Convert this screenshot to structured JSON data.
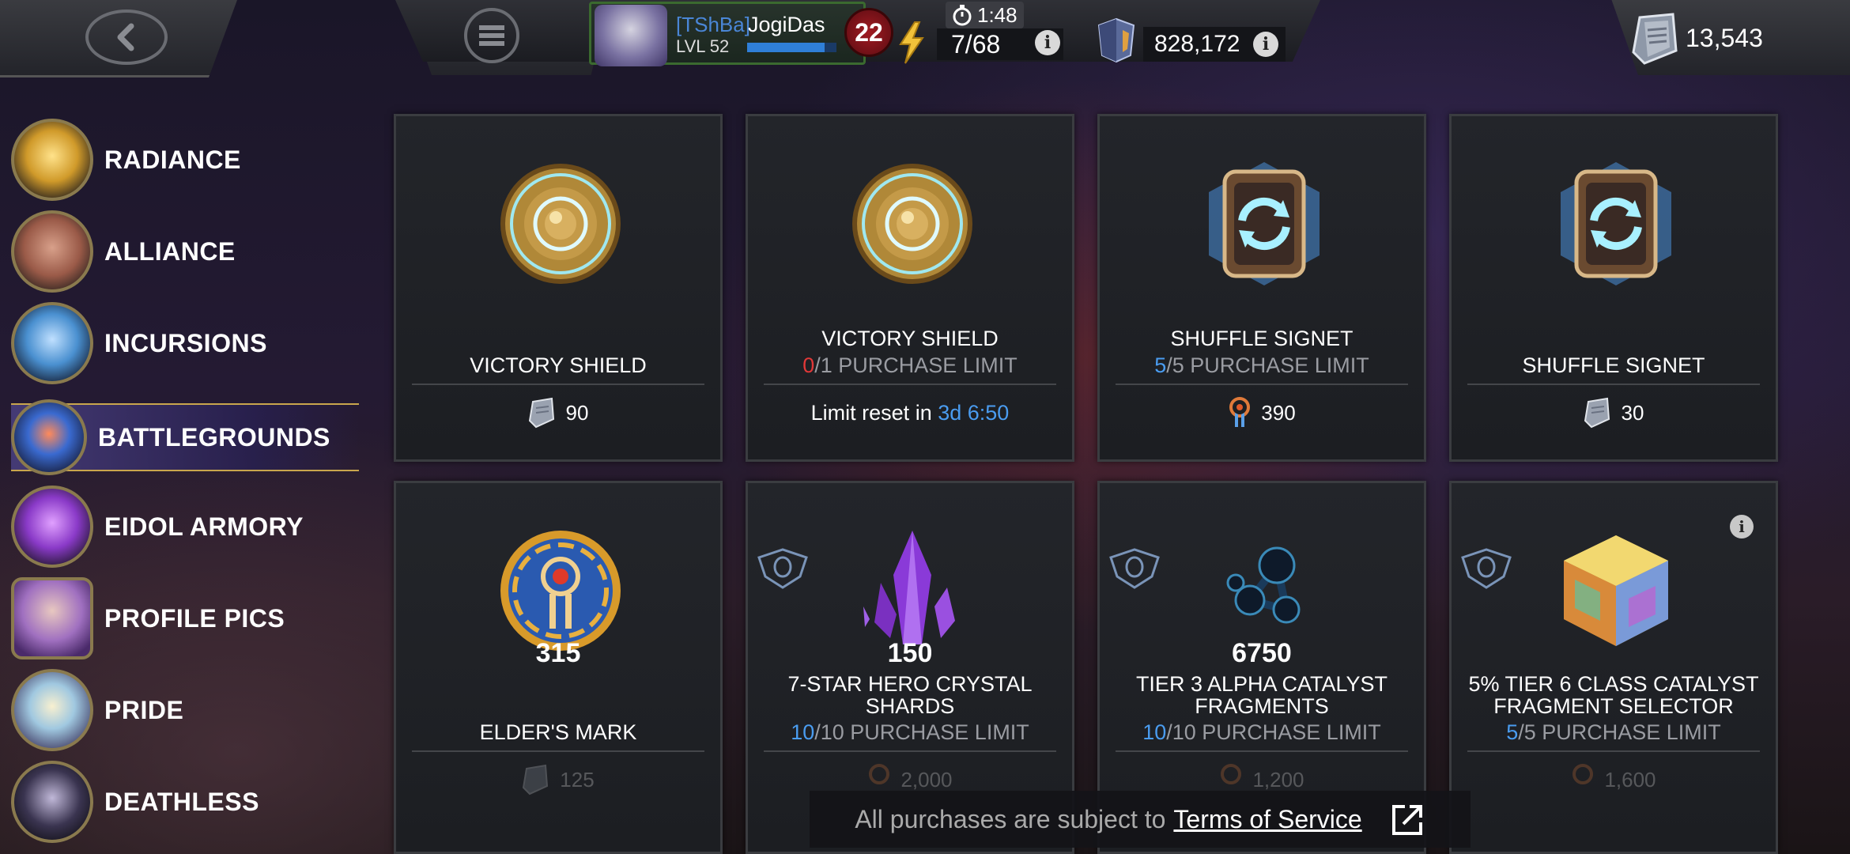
{
  "topbar": {
    "clan_tag": "[TShBa]",
    "player_name": "JogiDas",
    "level": "LVL 52",
    "level_badge": "22",
    "xp_progress": 0.87,
    "timer": "1:48",
    "energy": "7/68",
    "units": "828,172",
    "battlegrounds_currency": "13,543",
    "icons": {
      "back": "back-arrow-icon",
      "menu": "menu-icon",
      "energy": "lightning-icon",
      "timer": "stopwatch-icon",
      "units": "units-crystal-icon",
      "bg_currency": "glory-token-icon",
      "info": "info-icon"
    }
  },
  "sidebar": {
    "items": [
      {
        "label": "RADIANCE",
        "icon": "radiance-icon"
      },
      {
        "label": "ALLIANCE",
        "icon": "alliance-shield-icon"
      },
      {
        "label": "INCURSIONS",
        "icon": "incursions-icon"
      },
      {
        "label": "BATTLEGROUNDS",
        "icon": "battlegrounds-icon",
        "active": true
      },
      {
        "label": "EIDOL ARMORY",
        "icon": "eidol-armory-icon"
      },
      {
        "label": "PROFILE PICS",
        "icon": "profile-pic-icon"
      },
      {
        "label": "PRIDE",
        "icon": "pride-icon"
      },
      {
        "label": "DEATHLESS",
        "icon": "deathless-icon"
      }
    ]
  },
  "cards": [
    {
      "name": "VICTORY SHIELD",
      "price": "90",
      "currency_icon": "glory-token-icon"
    },
    {
      "name": "VICTORY SHIELD",
      "limit_current": "0",
      "limit_rest": "/1 PURCHASE LIMIT",
      "reset_prefix": "Limit reset in",
      "reset_time": "3d 6:50"
    },
    {
      "name": "SHUFFLE SIGNET",
      "limit_current": "5",
      "limit_rest": "/5 PURCHASE LIMIT",
      "price": "390",
      "currency_icon": "battlegrounds-token-icon"
    },
    {
      "name": "SHUFFLE SIGNET",
      "price": "30",
      "currency_icon": "glory-token-icon"
    },
    {
      "name": "ELDER'S MARK",
      "quantity": "315",
      "price": "125",
      "currency_icon": "glory-token-icon"
    },
    {
      "name": "7-STAR HERO CRYSTAL SHARDS",
      "quantity": "150",
      "limit_current": "10",
      "limit_rest": "/10 PURCHASE LIMIT",
      "price": "2,000",
      "currency_icon": "battlegrounds-token-icon"
    },
    {
      "name": "TIER 3 ALPHA CATALYST FRAGMENTS",
      "quantity": "6750",
      "limit_current": "10",
      "limit_rest": "/10 PURCHASE LIMIT",
      "price": "1,200",
      "currency_icon": "battlegrounds-token-icon"
    },
    {
      "name": "5% TIER 6 CLASS CATALYST FRAGMENT SELECTOR",
      "limit_current": "5",
      "limit_rest": "/5 PURCHASE LIMIT",
      "price": "1,600",
      "currency_icon": "battlegrounds-token-icon"
    }
  ],
  "footer": {
    "text": "All purchases are subject to",
    "link": "Terms of Service"
  },
  "colors": {
    "accent_blue": "#4a9cf0",
    "limit_red": "#e23838",
    "active_border": "#c9a64d"
  }
}
